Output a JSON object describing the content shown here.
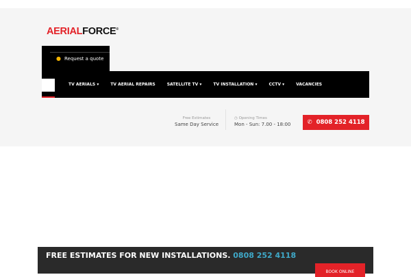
{
  "logo": {
    "part1": "AERIAL",
    "part2": "FORCE",
    "mark": "®"
  },
  "quote": {
    "icon": "chat-bubbles-icon",
    "label": "Request a quote"
  },
  "nav": {
    "items": [
      {
        "label": "TV AERIALS",
        "dropdown": "▾"
      },
      {
        "label": "TV AERIAL REPAIRS",
        "dropdown": ""
      },
      {
        "label": "SATELLITE TV",
        "dropdown": "▾"
      },
      {
        "label": "TV INSTALLATION",
        "dropdown": "▾"
      },
      {
        "label": "CCTV",
        "dropdown": "▾"
      },
      {
        "label": "VACANCIES",
        "dropdown": ""
      }
    ]
  },
  "info": {
    "estimates_small": "Free Estimates",
    "estimates": "Same Day Service",
    "hours_small": "Opening Times",
    "hours": "Mon - Sun: 7.00 - 18:00"
  },
  "call": {
    "icon": "phone-icon",
    "number": "0808 252 4118"
  },
  "banner": {
    "text": "FREE ESTIMATES FOR NEW INSTALLATIONS.",
    "phone": "0808 252 4118",
    "button": "BOOK ONLINE"
  },
  "colors": {
    "brand": "#e32228",
    "accent": "#3fa9c9"
  }
}
